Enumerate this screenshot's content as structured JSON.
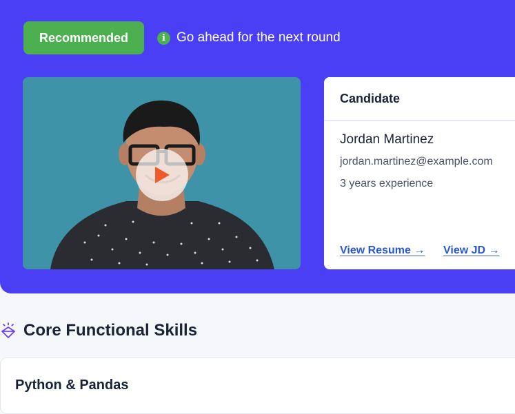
{
  "status": {
    "badge_label": "Recommended",
    "note": "Go ahead for the next round",
    "badge_color": "#4caf50",
    "icon": "info-icon"
  },
  "video": {
    "icon": "play-icon",
    "play_color": "#f05a28"
  },
  "candidate": {
    "heading": "Candidate",
    "name": "Jordan Martinez",
    "email": "jordan.martinez@example.com",
    "experience": "3 years experience",
    "resume_link": "View Resume →",
    "jd_link": "View JD →",
    "link_color": "#2a56d8"
  },
  "skills": {
    "section_title": "Core Functional Skills",
    "section_icon": "gem-icon",
    "first_skill": "Python & Pandas"
  },
  "theme": {
    "hero_bg": "#4a3ff5"
  }
}
